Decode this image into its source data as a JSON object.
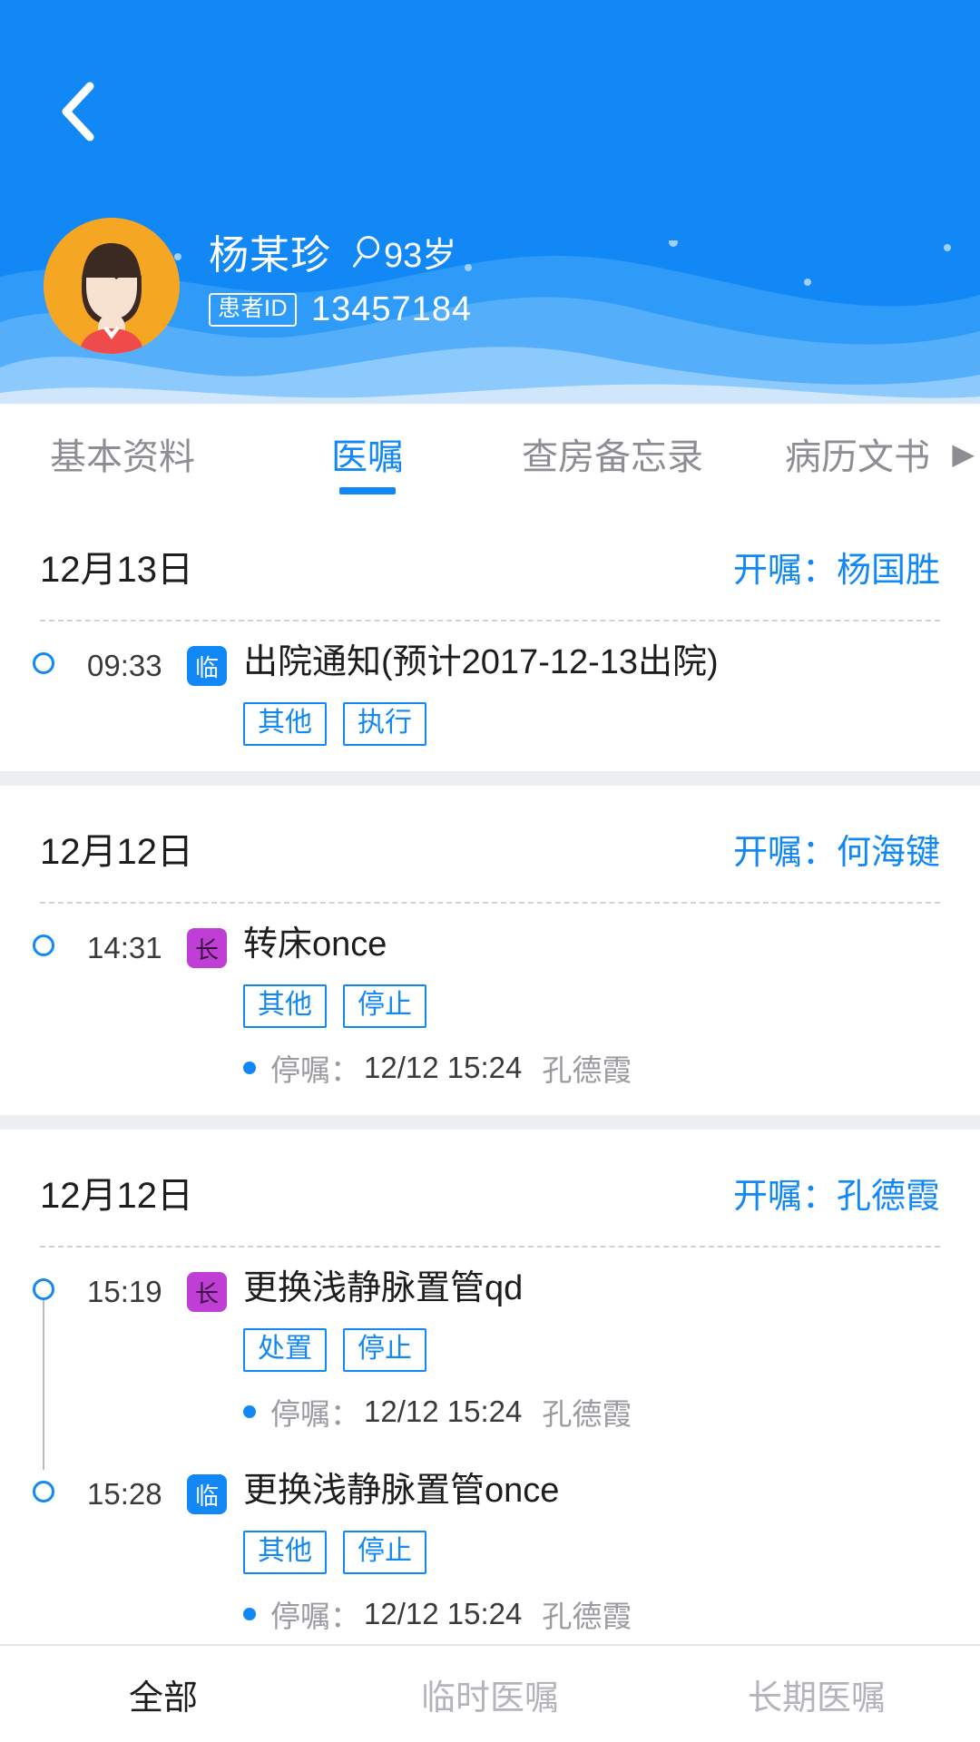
{
  "colors": {
    "brand_blue": "#1188f5",
    "header_bg": "#1188f5",
    "avatar_bg": "#f5a623",
    "badge_long": "#bf3fd6",
    "badge_temp": "#1188f5",
    "page_bg": "#eceef0"
  },
  "header": {
    "back_icon": "chevron-left-icon",
    "patient": {
      "name": "杨某珍",
      "gender_icon": "female-icon",
      "age": "93岁",
      "id_label": "患者ID",
      "id_value": "13457184",
      "avatar_icon": "patient-avatar"
    }
  },
  "tabs": [
    {
      "label": "基本资料",
      "active": false
    },
    {
      "label": "医嘱",
      "active": true
    },
    {
      "label": "查房备忘录",
      "active": false
    },
    {
      "label": "病历文书",
      "active": false,
      "arrow": "▶"
    }
  ],
  "orders": [
    {
      "date": "12月13日",
      "doctor_label": "开嘱：",
      "doctor": "杨国胜",
      "items": [
        {
          "time": "09:33",
          "kind": "临",
          "kind_type": "lin",
          "name": "出院通知(预计2017-12-13出院)",
          "tags": [
            "其他",
            "执行"
          ],
          "stop": null,
          "linked": false
        }
      ]
    },
    {
      "date": "12月12日",
      "doctor_label": "开嘱：",
      "doctor": "何海键",
      "items": [
        {
          "time": "14:31",
          "kind": "长",
          "kind_type": "chang",
          "name": "转床once",
          "tags": [
            "其他",
            "停止"
          ],
          "stop": {
            "label": "停嘱：",
            "time": "12/12 15:24",
            "who": "孔德霞"
          },
          "linked": false
        }
      ]
    },
    {
      "date": "12月12日",
      "doctor_label": "开嘱：",
      "doctor": "孔德霞",
      "items": [
        {
          "time": "15:19",
          "kind": "长",
          "kind_type": "chang",
          "name": "更换浅静脉置管qd",
          "tags": [
            "处置",
            "停止"
          ],
          "stop": {
            "label": "停嘱：",
            "time": "12/12 15:24",
            "who": "孔德霞"
          },
          "linked": true
        },
        {
          "time": "15:28",
          "kind": "临",
          "kind_type": "lin",
          "name": "更换浅静脉置管once",
          "tags": [
            "其他",
            "停止"
          ],
          "stop": {
            "label": "停嘱：",
            "time": "12/12 15:24",
            "who": "孔德霞"
          },
          "linked": false
        }
      ]
    }
  ],
  "bottom_tabs": [
    {
      "label": "全部",
      "active": true
    },
    {
      "label": "临时医嘱",
      "active": false
    },
    {
      "label": "长期医嘱",
      "active": false
    }
  ]
}
